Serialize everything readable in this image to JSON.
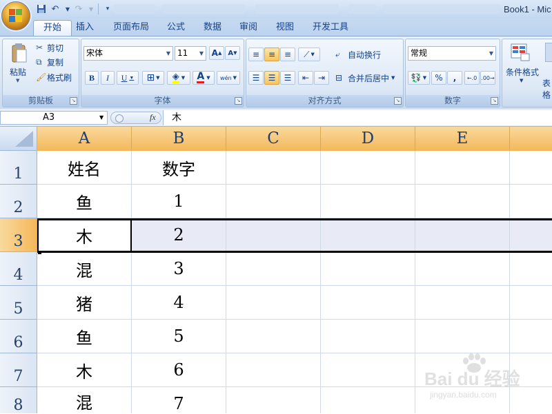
{
  "window": {
    "title": "Book1 - Mic"
  },
  "tabs": [
    "开始",
    "插入",
    "页面布局",
    "公式",
    "数据",
    "审阅",
    "视图",
    "开发工具"
  ],
  "clipboard": {
    "paste": "粘贴",
    "cut": "剪切",
    "copy": "复制",
    "format_painter": "格式刷",
    "label": "剪贴板"
  },
  "font": {
    "family": "宋体",
    "size": "11",
    "grow": "A",
    "shrink": "A",
    "bold": "B",
    "italic": "I",
    "underline": "U",
    "font_color_glyph": "A",
    "phonetic": "wén",
    "label": "字体"
  },
  "alignment": {
    "wrap": "自动换行",
    "merge": "合并后居中",
    "label": "对齐方式"
  },
  "number": {
    "format": "常规",
    "percent": "%",
    "comma": ",",
    "label": "数字"
  },
  "styles": {
    "conditional": "条件格式",
    "table": "表格"
  },
  "formula_bar": {
    "name_box": "A3",
    "fx": "fx",
    "value": "木"
  },
  "columns": [
    "A",
    "B",
    "C",
    "D",
    "E"
  ],
  "rows": [
    {
      "num": "1",
      "a": "姓名",
      "b": "数字"
    },
    {
      "num": "2",
      "a": "鱼",
      "b": "1"
    },
    {
      "num": "3",
      "a": "木",
      "b": "2"
    },
    {
      "num": "4",
      "a": "混",
      "b": "3"
    },
    {
      "num": "5",
      "a": "猪",
      "b": "4"
    },
    {
      "num": "6",
      "a": "鱼",
      "b": "5"
    },
    {
      "num": "7",
      "a": "木",
      "b": "6"
    },
    {
      "num": "8",
      "a": "混",
      "b": "7"
    }
  ],
  "selection": {
    "active_cell": "A3",
    "selected_row": "3"
  },
  "watermark": {
    "brand": "Bai du 经验",
    "url": "jingyan.baidu.com"
  },
  "colors": {
    "selected_header": "#f4b85a",
    "ribbon": "#dbe7f6",
    "grid_line": "#d0d7e5"
  }
}
